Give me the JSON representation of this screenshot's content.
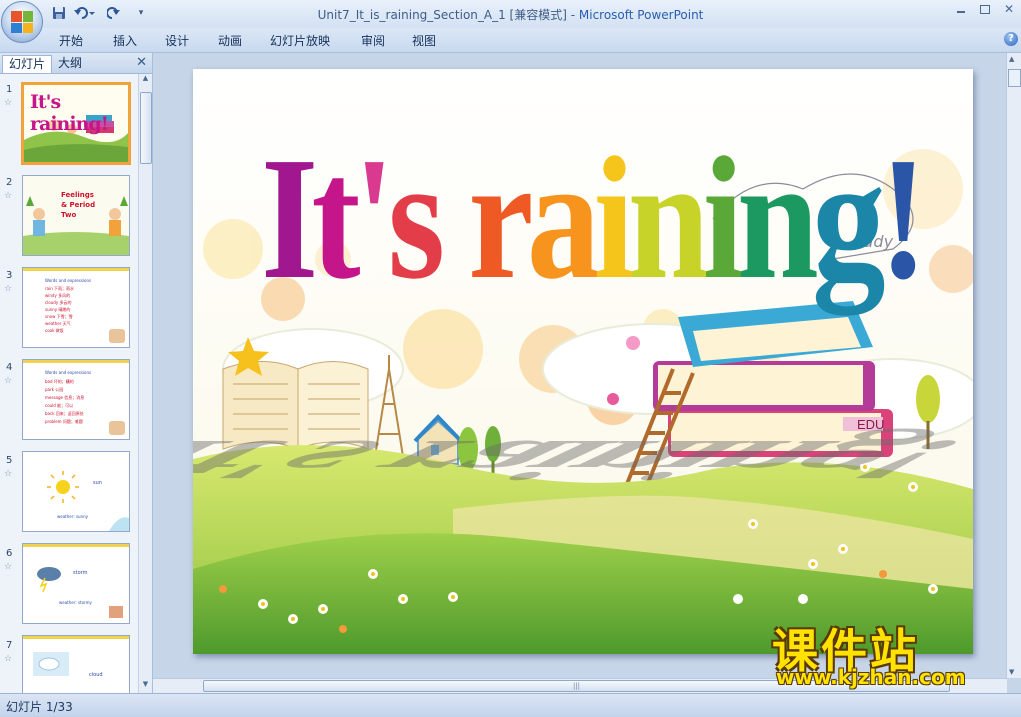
{
  "window": {
    "title_doc": "Unit7_It_is_raining_Section_A_1 [兼容模式] - ",
    "title_app": "Microsoft PowerPoint",
    "close_glyph": "✕",
    "help_glyph": "?"
  },
  "ribbon": {
    "tabs": [
      "开始",
      "插入",
      "设计",
      "动画",
      "幻灯片放映",
      "审阅",
      "视图"
    ]
  },
  "panel": {
    "tab_slides": "幻灯片",
    "tab_outline": "大纲",
    "close_glyph": "✕",
    "thumbnails": [
      {
        "num": "1",
        "text": "It's raining!"
      },
      {
        "num": "2",
        "text": "Feelings & Period Two"
      },
      {
        "num": "3",
        "text": "Words and expressions",
        "lines": [
          "rain 下雨；雨水",
          "windy 多风的",
          "cloudy 多云的",
          "sunny 晴朗的",
          "snow 下雪；雪",
          "weather 天气",
          "cook 做饭"
        ]
      },
      {
        "num": "4",
        "text": "Words and expressions",
        "lines": [
          "bad 坏的；糟的",
          "park 公园",
          "message 信息；消息",
          "could 能；可以",
          "back 回来；返回原处",
          "problem 问题；难题"
        ]
      },
      {
        "num": "5",
        "text": "sun",
        "sub": "weather: sunny"
      },
      {
        "num": "6",
        "text": "storm",
        "sub": "weather: stormy"
      },
      {
        "num": "7",
        "text": "cloud"
      }
    ]
  },
  "slide": {
    "title": "It's raining!",
    "reflection": "It's raining!",
    "title_colors": [
      "#a1178f",
      "#c4168a",
      "#d93a8f",
      "#e43d4a",
      "#ef5a24",
      "#f7941d",
      "#f6c51b",
      "#c8d32a",
      "#5aa838",
      "#1b9960",
      "#1c86a8",
      "#2b56a8",
      "#5b3aa0",
      "#8a2a9c"
    ],
    "study_text": "tudy",
    "book_label": "EDU"
  },
  "status": {
    "slide_indicator": "幻灯片 1/33"
  },
  "watermark": {
    "title": "课件站",
    "url": "www.kjzhan.com"
  }
}
